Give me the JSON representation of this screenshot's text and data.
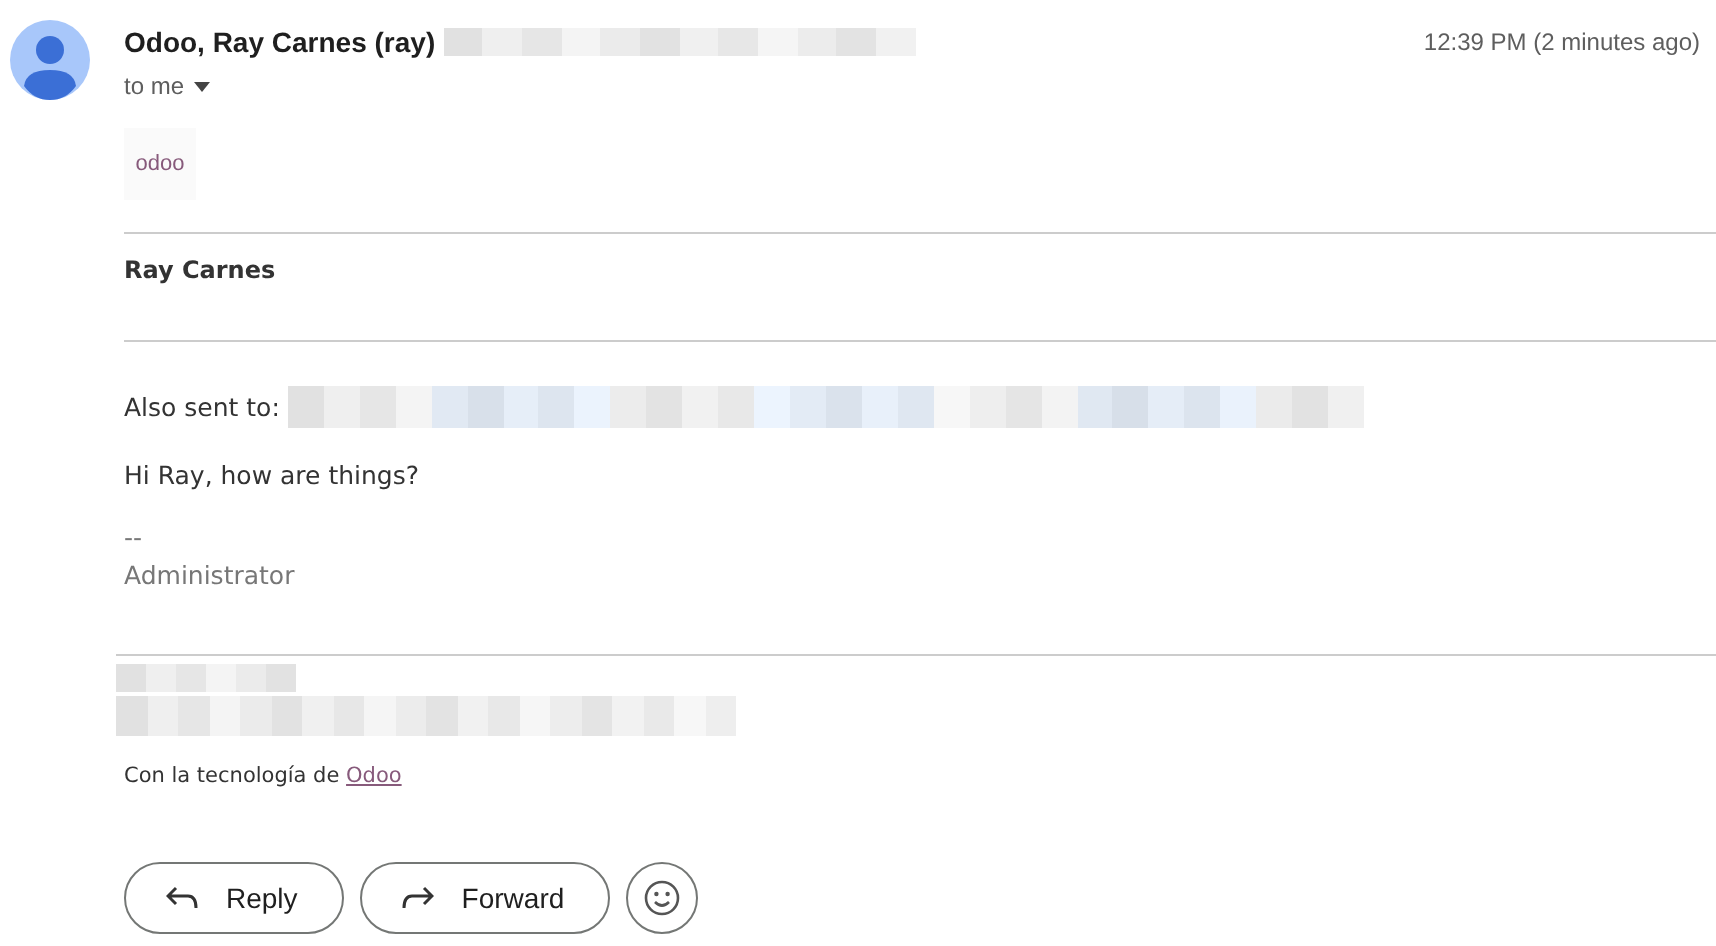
{
  "sender": {
    "name": "Odoo, Ray Carnes (ray)",
    "recipient": "to me",
    "time": "12:39 PM (2 minutes ago)"
  },
  "message": {
    "logo": "odoo",
    "author": "Ray Carnes",
    "also_sent_label": "Also sent to:",
    "body": "Hi Ray, how are things?",
    "signature_separator": "--",
    "signature": "Administrator",
    "footer_text": "Con la tecnología de",
    "footer_link": "Odoo"
  },
  "actions": [
    {
      "kind": "reply",
      "label": "Reply"
    },
    {
      "kind": "forward",
      "label": "Forward"
    },
    {
      "kind": "emoji"
    }
  ]
}
